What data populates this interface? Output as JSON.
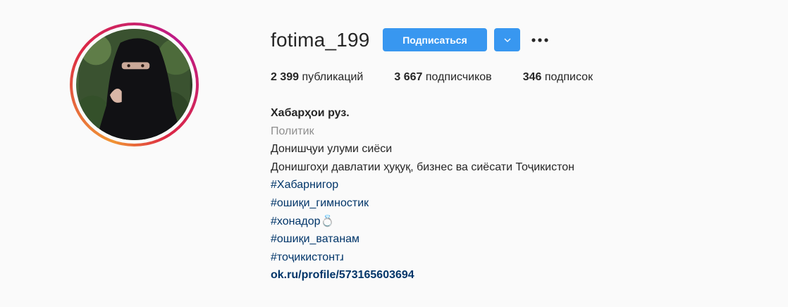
{
  "profile": {
    "username": "fotima_199",
    "follow_label": "Подписаться",
    "avatar_icon": "profile-photo"
  },
  "stats": [
    {
      "count": "2 399",
      "label": "публикаций"
    },
    {
      "count": "3 667",
      "label": "подписчиков"
    },
    {
      "count": "346",
      "label": "подписок"
    }
  ],
  "bio": {
    "name": "Хабарҳои руз.",
    "category": "Политик",
    "lines": [
      "Донишҷуи улуми сиёси",
      "Донишгоҳи давлатии ҳуқуқ, бизнес ва сиёсати Тоҷикистон"
    ],
    "tags": [
      "#Хабарнигор",
      "#ошиқи_гимностик",
      "#хонадор💍",
      "#ошиқи_ватанам",
      "#тоҷикистонтɹ"
    ],
    "link": "ok.ru/profile/573165603694"
  },
  "colors": {
    "accent": "#3897f0",
    "link": "#003569",
    "muted": "#8e8e8e",
    "background": "#fafafa"
  }
}
